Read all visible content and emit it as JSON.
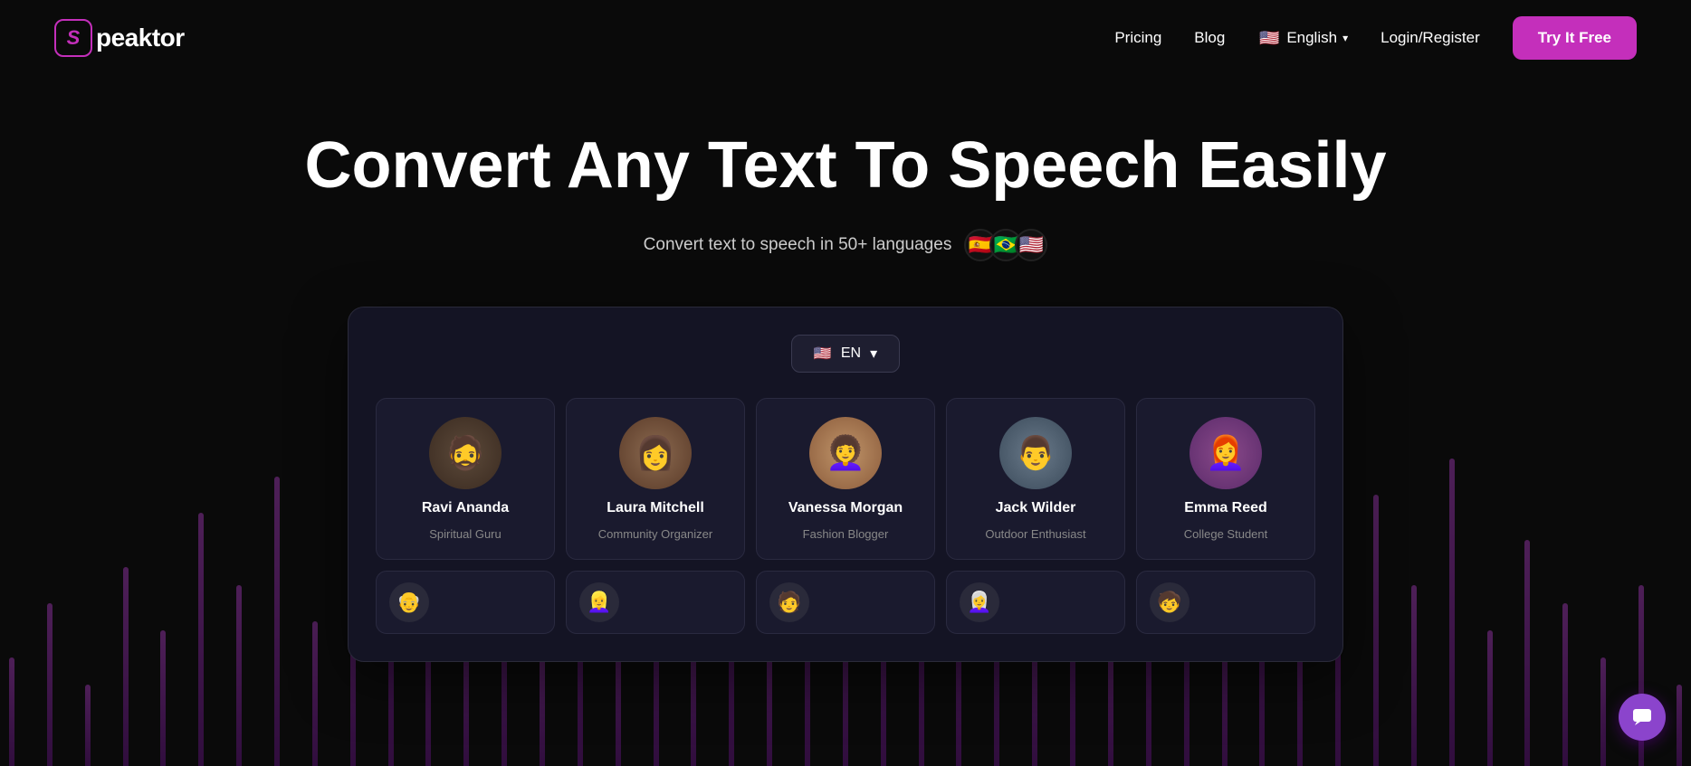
{
  "nav": {
    "logo_letter": "S",
    "logo_name": "peaktor",
    "links": [
      {
        "id": "pricing",
        "label": "Pricing"
      },
      {
        "id": "blog",
        "label": "Blog"
      }
    ],
    "language": {
      "flag": "🇺🇸",
      "label": "English",
      "chevron": "▾"
    },
    "login_label": "Login/Register",
    "cta_label": "Try It Free"
  },
  "hero": {
    "title": "Convert Any Text To Speech Easily",
    "subtitle": "Convert text to speech in 50+ languages",
    "flags": [
      "🇪🇸",
      "🇧🇷",
      "🇺🇸"
    ]
  },
  "app": {
    "lang_selector": {
      "flag": "🇺🇸",
      "label": "EN",
      "chevron": "▾"
    },
    "voices_row1": [
      {
        "id": "ravi",
        "name": "Ravi Ananda",
        "role": "Spiritual Guru",
        "emoji": "🧔",
        "avatar_class": "avatar-ravi"
      },
      {
        "id": "laura",
        "name": "Laura Mitchell",
        "role": "Community Organizer",
        "emoji": "👩",
        "avatar_class": "avatar-laura"
      },
      {
        "id": "vanessa",
        "name": "Vanessa Morgan",
        "role": "Fashion Blogger",
        "emoji": "👩‍🦱",
        "avatar_class": "avatar-vanessa"
      },
      {
        "id": "jack",
        "name": "Jack Wilder",
        "role": "Outdoor Enthusiast",
        "emoji": "👨",
        "avatar_class": "avatar-jack"
      },
      {
        "id": "emma",
        "name": "Emma Reed",
        "role": "College Student",
        "emoji": "👩‍🦰",
        "avatar_class": "avatar-emma"
      }
    ],
    "voices_row2": [
      {
        "id": "r2a",
        "emoji": "👴"
      },
      {
        "id": "r2b",
        "emoji": "👱‍♀️"
      },
      {
        "id": "r2c",
        "emoji": "🧑"
      },
      {
        "id": "r2d",
        "emoji": "👩‍🦳"
      },
      {
        "id": "r2e",
        "emoji": "🧒"
      }
    ]
  },
  "chat": {
    "icon_label": "💬"
  }
}
